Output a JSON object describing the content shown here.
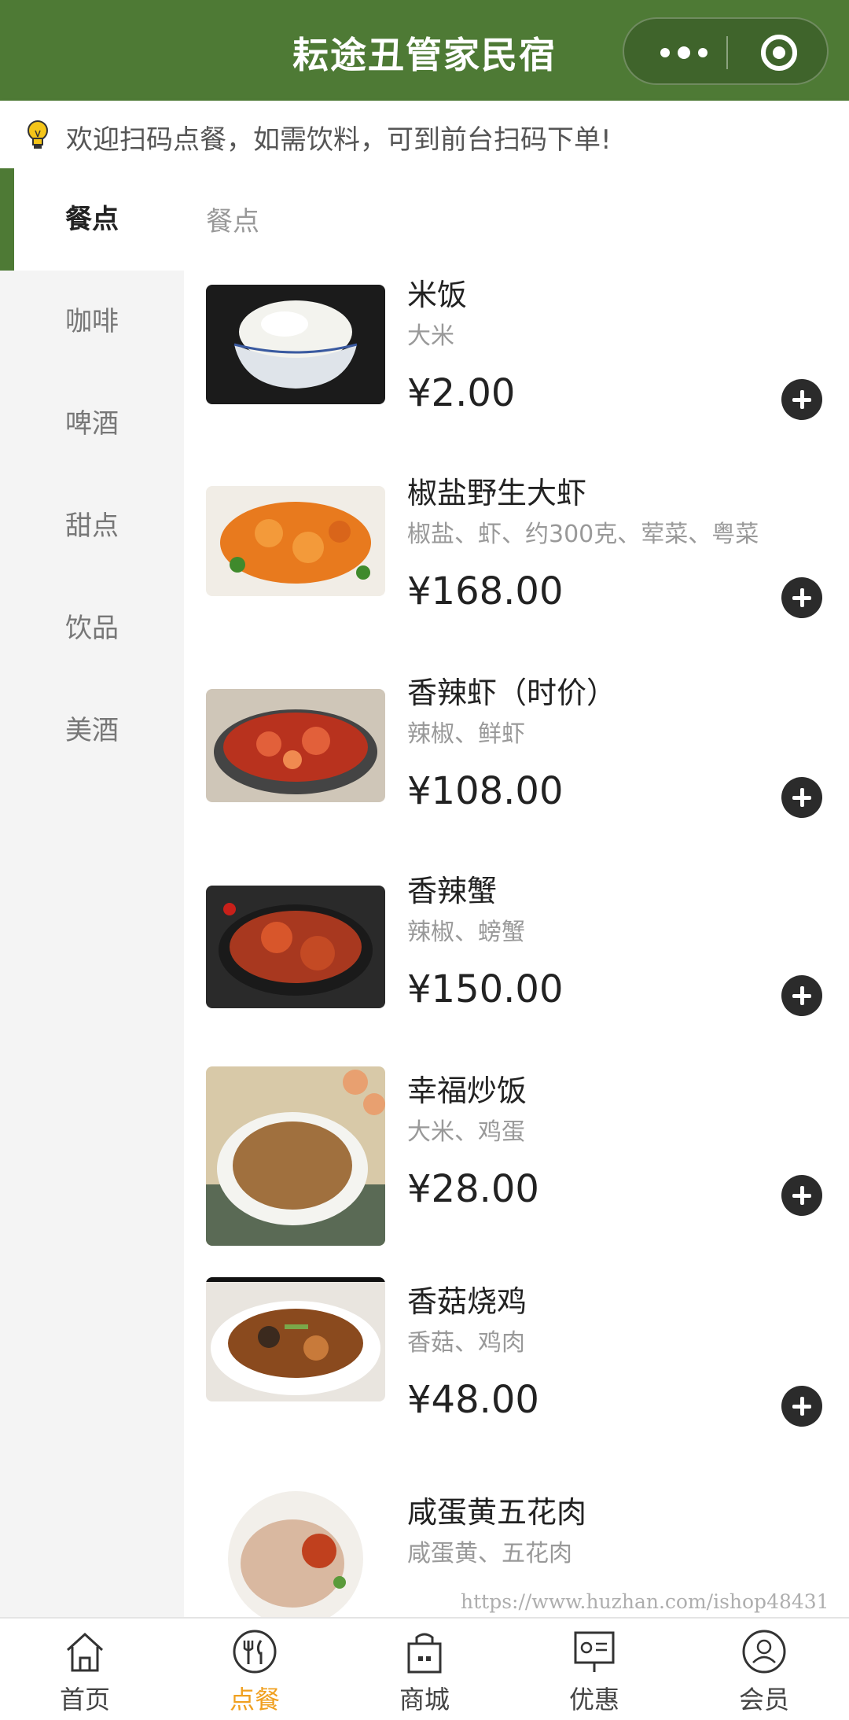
{
  "header": {
    "title": "耘途丑管家民宿"
  },
  "notice": {
    "text": "欢迎扫码点餐，如需饮料，可到前台扫码下单!"
  },
  "sidebar": {
    "items": [
      {
        "label": "餐点",
        "active": true
      },
      {
        "label": "咖啡"
      },
      {
        "label": "啤酒"
      },
      {
        "label": "甜点"
      },
      {
        "label": "饮品"
      },
      {
        "label": "美酒"
      }
    ]
  },
  "content": {
    "category": "餐点",
    "dishes": [
      {
        "name": "米饭",
        "desc": "大米",
        "price": "¥2.00"
      },
      {
        "name": "椒盐野生大虾",
        "desc": "椒盐、虾、约300克、荤菜、粤菜",
        "price": "¥168.00"
      },
      {
        "name": "香辣虾（时价）",
        "desc": "辣椒、鲜虾",
        "price": "¥108.00"
      },
      {
        "name": "香辣蟹",
        "desc": "辣椒、螃蟹",
        "price": "¥150.00"
      },
      {
        "name": "幸福炒饭",
        "desc": "大米、鸡蛋",
        "price": "¥28.00"
      },
      {
        "name": "香菇烧鸡",
        "desc": "香菇、鸡肉",
        "price": "¥48.00"
      },
      {
        "name": "咸蛋黄五花肉",
        "desc": "咸蛋黄、五花肉",
        "price": ""
      }
    ]
  },
  "watermark": "https://www.huzhan.com/ishop48431",
  "tabbar": {
    "items": [
      {
        "label": "首页",
        "icon": "home-icon"
      },
      {
        "label": "点餐",
        "icon": "dining-icon",
        "active": true
      },
      {
        "label": "商城",
        "icon": "shopping-bag-icon"
      },
      {
        "label": "优惠",
        "icon": "coupon-board-icon"
      },
      {
        "label": "会员",
        "icon": "member-icon"
      }
    ],
    "active_color": "#f0a020"
  },
  "colors": {
    "brand": "#4e7a35",
    "accent": "#f0a020",
    "add_button": "#2b2b2b"
  }
}
